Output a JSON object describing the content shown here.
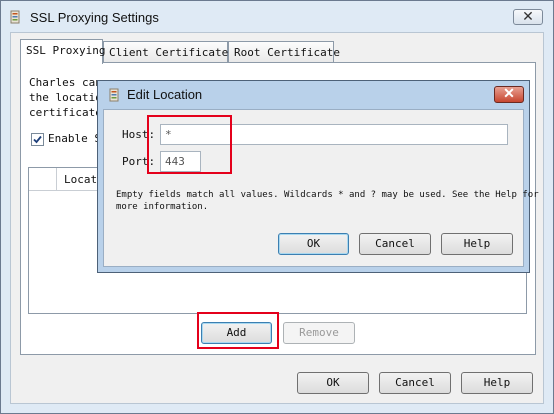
{
  "window": {
    "title": "SSL Proxying Settings",
    "close_glyph": "✕",
    "icon": "app-icon"
  },
  "tabs": [
    {
      "label": "SSL Proxying",
      "active": true
    },
    {
      "label": "Client Certificates",
      "active": false
    },
    {
      "label": "Root Certificate",
      "active": false
    }
  ],
  "ssl_tab": {
    "description": "Charles can\nthe location\ncertificate",
    "enable_label": "Enable S",
    "enable_checked": true,
    "locations_header": "Locati",
    "add_button": "Add",
    "remove_button": "Remove"
  },
  "footer": {
    "ok": "OK",
    "cancel": "Cancel",
    "help": "Help"
  },
  "dialog": {
    "title": "Edit Location",
    "close_glyph": "✕",
    "host_label": "Host:",
    "host_value": "*",
    "port_label": "Port:",
    "port_value": "443",
    "note": "Empty fields match all values. Wildcards * and ? may be used. See the Help for\nmore information.",
    "ok": "OK",
    "cancel": "Cancel",
    "help": "Help"
  },
  "colors": {
    "highlight_red": "#e4001b",
    "title_bar": "#dfeaf5",
    "dialog_title_bar": "#b9d1ea"
  }
}
